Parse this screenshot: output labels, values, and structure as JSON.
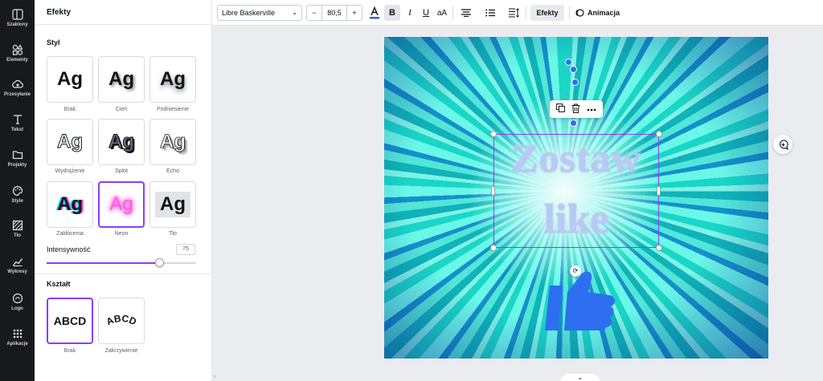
{
  "rail": [
    {
      "label": "Szablony",
      "icon": "templates-icon"
    },
    {
      "label": "Elementy",
      "icon": "elements-icon"
    },
    {
      "label": "Przesyłanie",
      "icon": "upload-icon"
    },
    {
      "label": "Tekst",
      "icon": "text-icon"
    },
    {
      "label": "Projekty",
      "icon": "folder-icon"
    },
    {
      "label": "Style",
      "icon": "palette-icon"
    },
    {
      "label": "Tło",
      "icon": "background-icon"
    },
    {
      "label": "Wykresy",
      "icon": "chart-icon"
    },
    {
      "label": "Logo",
      "icon": "logo-icon"
    },
    {
      "label": "Aplikacje",
      "icon": "apps-icon"
    }
  ],
  "panel": {
    "title": "Efekty",
    "style_section": "Styl",
    "sample": "Ag",
    "styles": [
      "Brak",
      "Cień",
      "Podniesienie",
      "Wydrążenie",
      "Splot",
      "Echo",
      "Zakłócenia",
      "Neon",
      "Tło"
    ],
    "selected_style": "Neon",
    "intensity_label": "Intensywność",
    "intensity_value": "75",
    "intensity_fraction": 0.75,
    "shape_section": "Kształt",
    "shape_sample": "ABCD",
    "shapes": [
      "Brak",
      "Zakrzywienie"
    ],
    "selected_shape": "Brak"
  },
  "toolbar": {
    "font_family": "Libre Baskerville",
    "minus": "−",
    "font_size": "80,5",
    "plus": "+",
    "case_label": "aA",
    "effects_label": "Efekty",
    "animation_label": "Animacja"
  },
  "canvas": {
    "line1": "Zostaw",
    "line2": "like",
    "accent": "#8b3dff",
    "thumb_color": "#2e6ef0"
  }
}
